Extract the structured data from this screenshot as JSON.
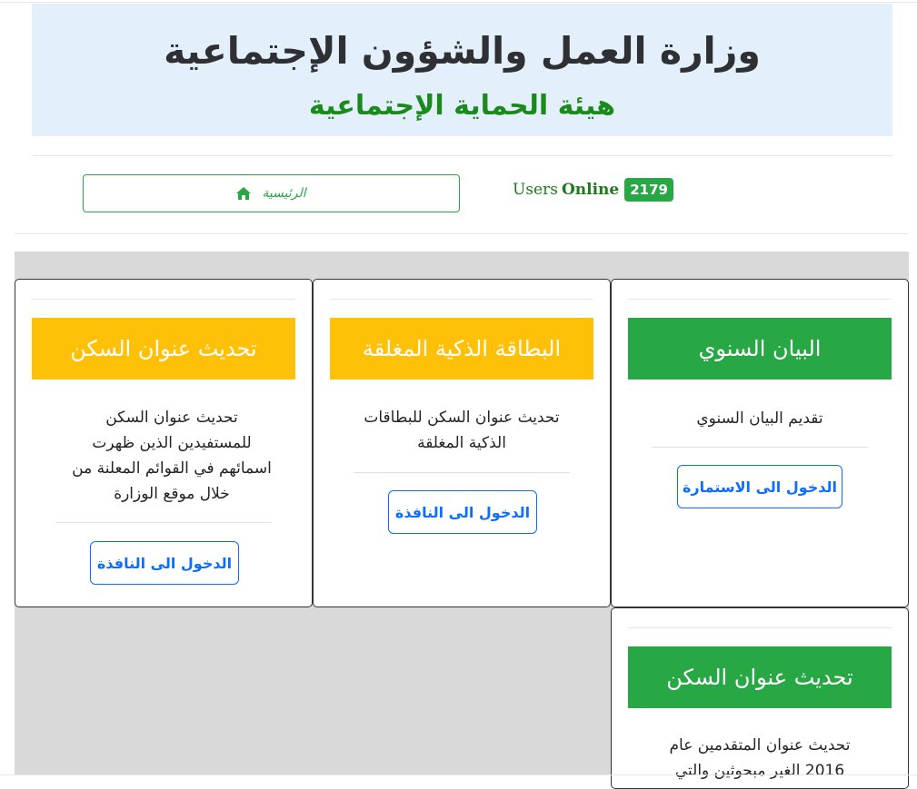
{
  "header": {
    "ministry_title": "وزارة العمل والشؤون الإجتماعية",
    "authority_subtitle": "هيئة الحماية الإجتماعية"
  },
  "nav": {
    "home_label": "الرئيسية",
    "home_icon": "home-icon"
  },
  "users_online": {
    "label_users": "Users",
    "label_online": "Online",
    "count": "2179"
  },
  "colors": {
    "green": "#28a745",
    "yellow": "#ffc107",
    "blue": "#0d6efd",
    "banner_bg": "#e3f0fb"
  },
  "cards": [
    {
      "title": "البيان السنوي",
      "description": "تقديم البيان السنوي",
      "button": "الدخول الى الاستمارة",
      "color": "green"
    },
    {
      "title": "البطاقة الذكية المغلقة",
      "description": "تحديث عنوان السكن للبطاقات الذكية المغلقة",
      "button": "الدخول الى النافذة",
      "color": "yellow"
    },
    {
      "title": "تحديث عنوان السكن",
      "description": "تحديث عنوان السكن للمستفيدين الذين ظهرت اسمائهم في القوائم المعلنة من خلال موقع الوزارة",
      "button": "الدخول الى النافذة",
      "color": "yellow"
    },
    {
      "title": "تحديث عنوان السكن",
      "description": "تحديث عنوان المتقدمين عام 2016 الغير مبحوثين والتي",
      "color": "green"
    }
  ]
}
